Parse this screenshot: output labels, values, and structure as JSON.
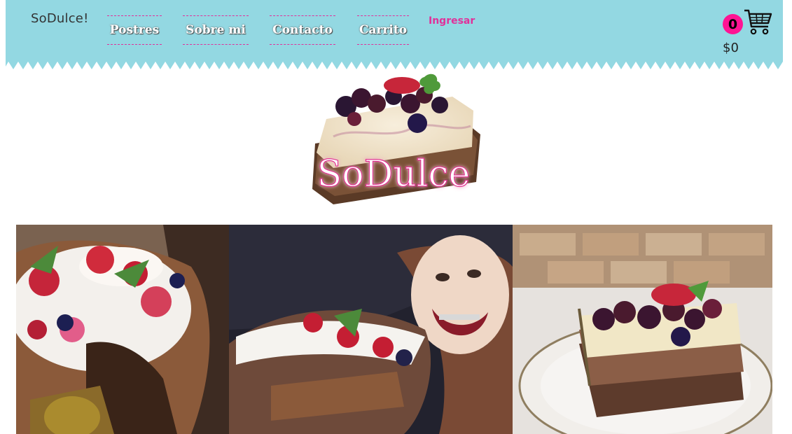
{
  "header": {
    "brand": "SoDulce!",
    "nav": [
      {
        "label": "Postres"
      },
      {
        "label": "Sobre mi"
      },
      {
        "label": "Contacto"
      },
      {
        "label": "Carrito"
      }
    ],
    "login": "Ingresar",
    "cart": {
      "count": "0",
      "total": "$0"
    },
    "colors": {
      "bar": "#93d8e2",
      "accent": "#e0319a",
      "badge": "#ff1493"
    }
  },
  "logo": {
    "text": "SoDulce"
  },
  "icons": {
    "cart": "shopping-cart-icon"
  },
  "gallery": {
    "photos": [
      {
        "name": "berry-pavlova-photo"
      },
      {
        "name": "girl-with-cake-photo"
      },
      {
        "name": "cheesecake-slice-photo"
      }
    ]
  }
}
